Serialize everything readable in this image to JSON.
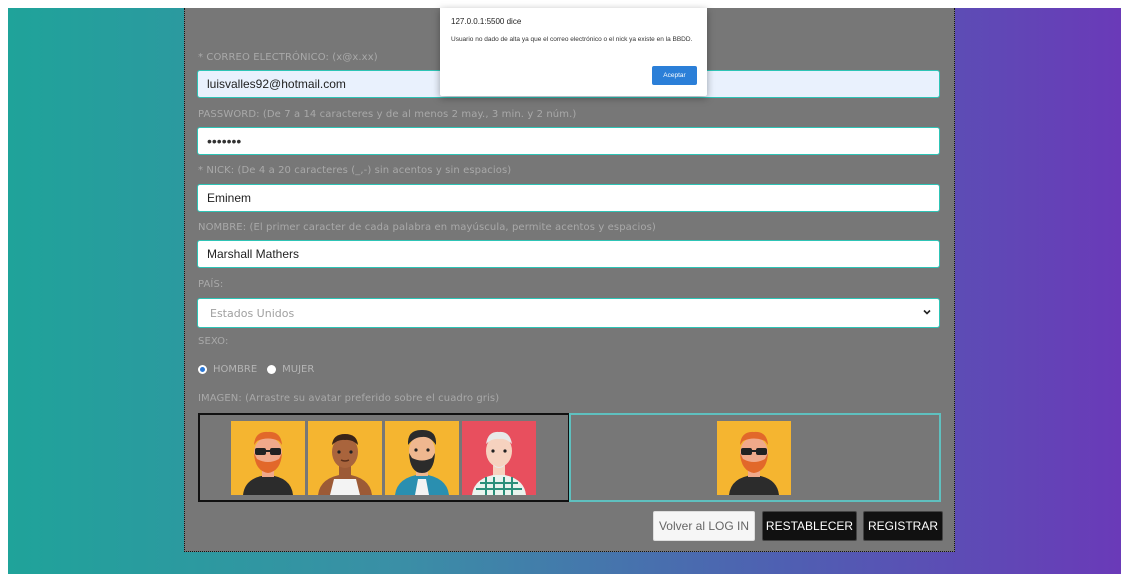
{
  "dialog": {
    "title": "127.0.0.1:5500 dice",
    "message": "Usuario no dado de alta ya que el correo electrónico o el nick ya existe en la BBDD.",
    "ok_label": "Aceptar"
  },
  "form": {
    "email": {
      "label": "* CORREO ELECTRÓNICO: (x@x.xx)",
      "value": "luisvalles92@hotmail.com"
    },
    "password": {
      "label": "PASSWORD: (De 7 a 14 caracteres y de al menos 2 may., 3 min. y 2 núm.)",
      "value": "•••••••"
    },
    "nick": {
      "label": "* NICK: (De 4 a 20 caracteres (_,-) sin acentos y sin espacios)",
      "value": "Eminem"
    },
    "name": {
      "label": "NOMBRE: (El primer caracter de cada palabra en mayúscula, permite acentos y espacios)",
      "value": "Marshall Mathers"
    },
    "country": {
      "label": "PAÍS:",
      "selected": "Estados Unidos"
    },
    "sex": {
      "label": "SEXO:",
      "options": [
        "HOMBRE",
        "MUJER"
      ],
      "selected": "HOMBRE"
    },
    "image": {
      "label": "IMAGEN: (Arrastre su avatar preferido sobre el cuadro gris)"
    }
  },
  "avatars": [
    {
      "name": "avatar-ginger-beard-sunglasses",
      "bg": "#f5b530"
    },
    {
      "name": "avatar-dark-skin-tank-top",
      "bg": "#f5b530"
    },
    {
      "name": "avatar-beard-teal-jacket",
      "bg": "#f5b530"
    },
    {
      "name": "avatar-plaid-shirt",
      "bg": "#e84f5e"
    }
  ],
  "buttons": {
    "back": "Volver al LOG IN",
    "reset": "RESTABLECER",
    "register": "REGISTRAR"
  },
  "colors": {
    "accent_border": "#2ec4b6",
    "panel_bg": "#777777",
    "dialog_button": "#2b7fd8"
  }
}
